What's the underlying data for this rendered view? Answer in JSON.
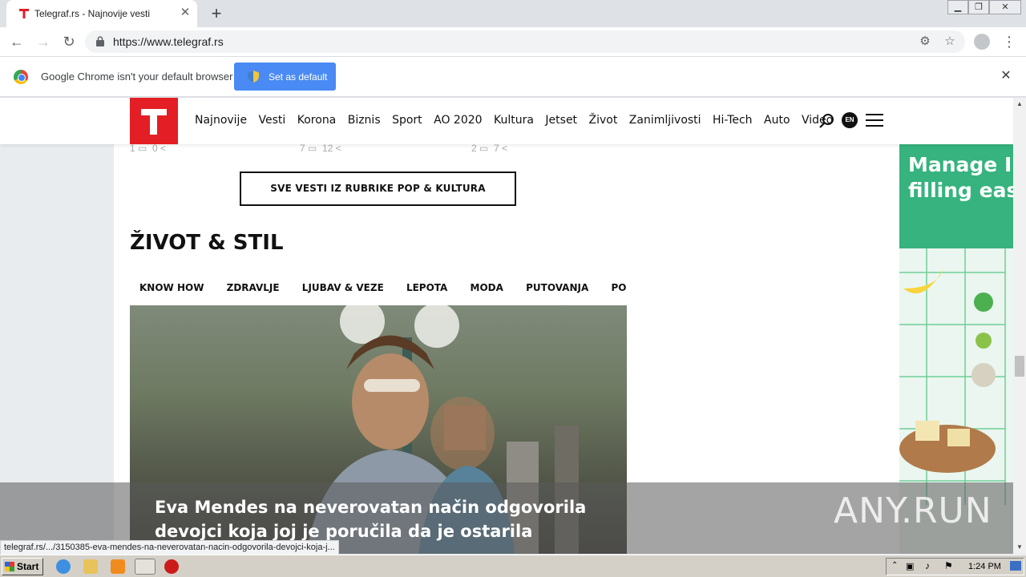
{
  "browser": {
    "tab_title": "Telegraf.rs - Najnovije vesti",
    "url": "https://www.telegraf.rs",
    "infobar_message": "Google Chrome isn't your default browser",
    "set_default_label": "Set as default",
    "status_url": "telegraf.rs/.../3150385-eva-mendes-na-neverovatan-nacin-odgovorila-devojci-koja-j..."
  },
  "site": {
    "nav": [
      "Najnovije",
      "Vesti",
      "Korona",
      "Biznis",
      "Sport",
      "AO 2020",
      "Kultura",
      "Jetset",
      "Život",
      "Zanimljivosti",
      "Hi-Tech",
      "Auto",
      "Video"
    ],
    "lang_badge": "EN",
    "meta": [
      {
        "comments": "1",
        "shares": "0"
      },
      {
        "comments": "7",
        "shares": "12"
      },
      {
        "comments": "2",
        "shares": "7"
      }
    ],
    "more_button": "SVE VESTI IZ RUBRIKE POP & KULTURA",
    "section_title": "ŽIVOT & STIL",
    "subnav": [
      "KNOW HOW",
      "ZDRAVLJE",
      "LJUBAV & VEZE",
      "LEPOTA",
      "MODA",
      "PUTOVANJA",
      "PORODICA"
    ],
    "hero_title_line1": "Eva Mendes na neverovatan način odgovorila",
    "hero_title_line2": "devojci koja joj je poručila da je ostarila"
  },
  "ad": {
    "line1": "Manage I",
    "line2": "filling eas",
    "accent": "#36b37e"
  },
  "watermark": "ANY.RUN",
  "taskbar": {
    "start_label": "Start",
    "clock": "1:24 PM"
  },
  "colors": {
    "brand_red": "#e31e24",
    "chrome_blue": "#4a8af4"
  }
}
